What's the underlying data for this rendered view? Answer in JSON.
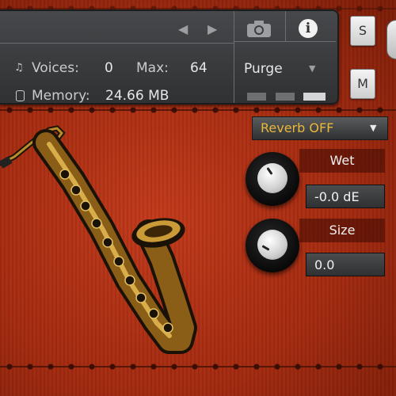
{
  "status": {
    "voices_label": "Voices:",
    "voices_value": "0",
    "max_label": "Max:",
    "max_value": "64",
    "memory_label": "Memory:",
    "memory_value": "24.66 MB",
    "purge_label": "Purge"
  },
  "side_buttons": {
    "solo": "S",
    "mute": "M"
  },
  "effects": {
    "reverb_selected": "Reverb OFF",
    "wet_label": "Wet",
    "wet_value": "-0.0 dE",
    "size_label": "Size",
    "size_value": "0.0"
  },
  "icons": [
    "left-arrow-icon",
    "right-arrow-icon",
    "camera-icon",
    "info-icon",
    "music-note-icon",
    "memory-icon",
    "caret-down-icon",
    "saxophone-image"
  ],
  "colors": {
    "background_red": "#a8280f",
    "reverb_text": "#e9b83a",
    "panel": "#3a3c3e"
  }
}
